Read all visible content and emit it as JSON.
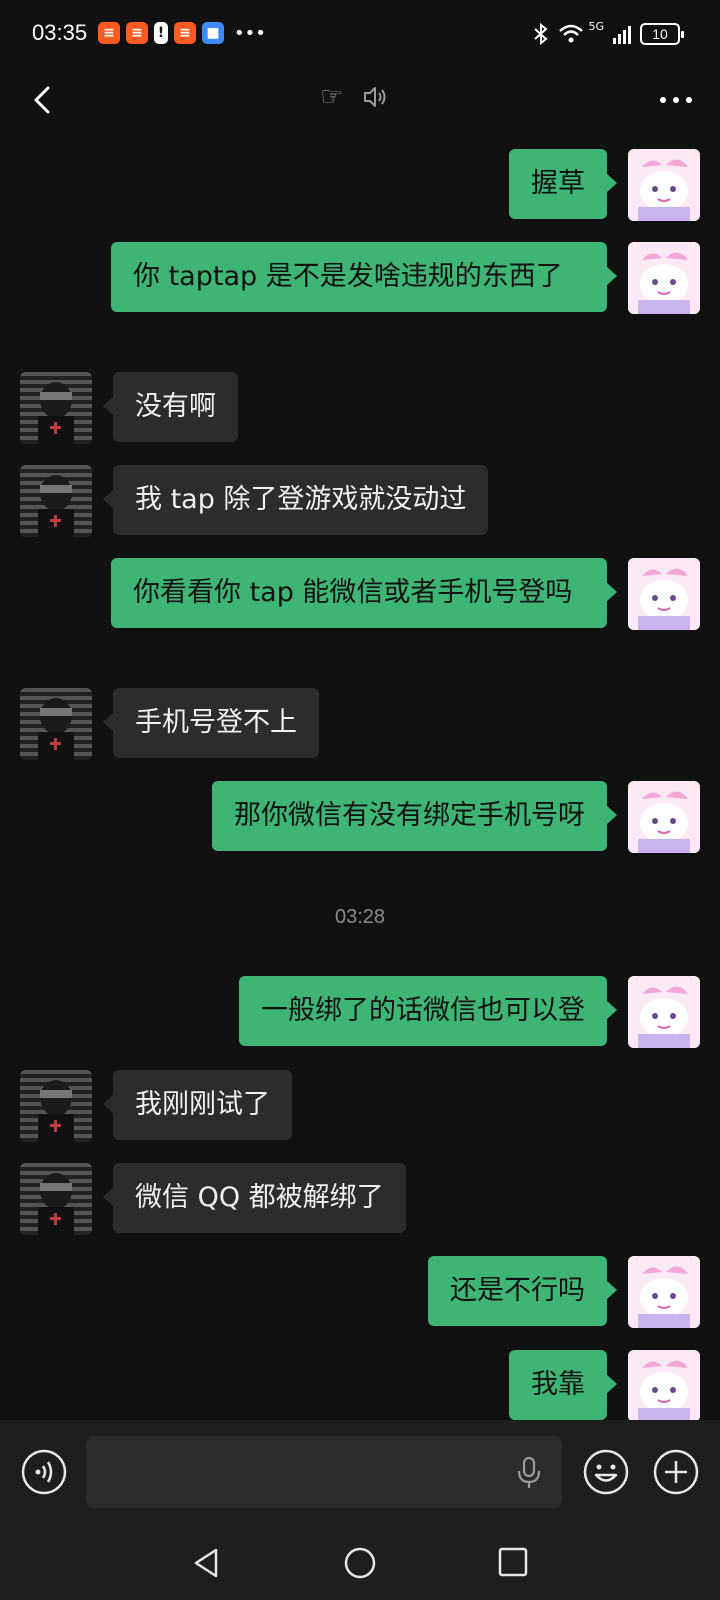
{
  "status_bar": {
    "time": "03:35",
    "notification_icons": [
      "shopping-app-icon",
      "shopping-app-icon",
      "alert-icon",
      "shopping-app-icon",
      "shield-app-icon"
    ],
    "more": "•••",
    "network": "5G",
    "battery": "10"
  },
  "header": {
    "back_icon": "chevron-left-icon",
    "title": "☞",
    "muted_icon": "speaker-icon",
    "more_icon": "more-dots-icon"
  },
  "messages": [
    {
      "side": "out",
      "text": "握草"
    },
    {
      "side": "out",
      "text": "你 taptap 是不是发啥违规的东西了"
    },
    {
      "side": "in",
      "text": "没有啊"
    },
    {
      "side": "in",
      "text": "我 tap 除了登游戏就没动过"
    },
    {
      "side": "out",
      "text": "你看看你 tap 能微信或者手机号登吗"
    },
    {
      "side": "in",
      "text": "手机号登不上"
    },
    {
      "side": "out",
      "text": "那你微信有没有绑定手机号呀"
    },
    {
      "side": "out",
      "text": "一般绑了的话微信也可以登"
    },
    {
      "side": "in",
      "text": "我刚刚试了"
    },
    {
      "side": "in",
      "text": "微信 QQ 都被解绑了"
    },
    {
      "side": "out",
      "text": "还是不行吗"
    },
    {
      "side": "out",
      "text": "我靠"
    }
  ],
  "timestamp": "03:28",
  "input_bar": {
    "placeholder": "",
    "voice_icon": "voice-mode-icon",
    "mic_icon": "microphone-icon",
    "emoji_icon": "emoji-icon",
    "plus_icon": "plus-icon"
  },
  "nav_bar": {
    "back_icon": "nav-back-icon",
    "home_icon": "nav-home-icon",
    "recent_icon": "nav-recent-icon"
  },
  "colors": {
    "background": "#111111",
    "outgoing_bubble": "#3eb575",
    "incoming_bubble": "#2c2c2c",
    "input_bar": "#1e1e1e"
  }
}
